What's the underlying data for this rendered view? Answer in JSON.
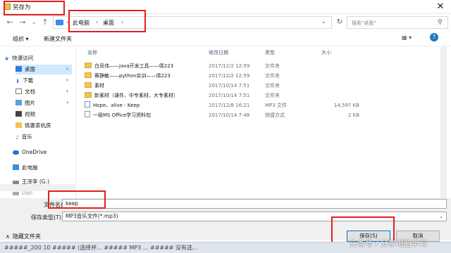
{
  "window": {
    "title": "另存为",
    "close_glyph": "✕"
  },
  "nav": {
    "back": "←",
    "forward": "→",
    "dropdown": "⌄",
    "up": "↑",
    "breadcrumb": [
      "此电脑",
      "桌面"
    ],
    "sep": "›",
    "refresh": "↻",
    "search_placeholder": "搜索\"桌面\""
  },
  "toolbar": {
    "organize": "组织 ▾",
    "new_folder": "新建文件夹",
    "view": "▦ ▾",
    "help": "?"
  },
  "sidebar": [
    {
      "label": "快速访问",
      "icon": "star-icon"
    },
    {
      "label": "桌面",
      "icon": "desktop-icon",
      "pin": "✦"
    },
    {
      "label": "下载",
      "icon": "download-icon",
      "pin": "✦"
    },
    {
      "label": "文档",
      "icon": "document-icon",
      "pin": "✦"
    },
    {
      "label": "图片",
      "icon": "picture-icon",
      "pin": "✦"
    },
    {
      "label": "视频",
      "icon": "video-icon"
    },
    {
      "label": "倩惠茶杭房",
      "icon": "folder-icon"
    },
    {
      "label": "音乐",
      "icon": "music-icon"
    },
    {
      "label": "OneDrive",
      "icon": "cloud-icon"
    },
    {
      "label": "此电脑",
      "icon": "computer-icon"
    },
    {
      "label": "王泽李 (G:)",
      "icon": "drive-icon"
    },
    {
      "label": "Dan",
      "icon": "drive-icon"
    }
  ],
  "columns": {
    "name": "名称",
    "modified": "修改日期",
    "type": "类型",
    "size": "大小"
  },
  "files": [
    {
      "name": "白凤伟——java开发工具——倩223",
      "date": "2017/12/2 12:59",
      "type": "文件夹",
      "size": "",
      "icon": "folder-icon"
    },
    {
      "name": "蔡静敏——python实训——倩223",
      "date": "2017/12/2 12:59",
      "type": "文件夹",
      "size": "",
      "icon": "folder-icon"
    },
    {
      "name": "素材",
      "date": "2017/10/14 7:51",
      "type": "文件夹",
      "size": "",
      "icon": "folder-icon"
    },
    {
      "name": "新素材（课件、中专素材、大专素材）",
      "date": "2017/10/14 7:51",
      "type": "文件夹",
      "size": "",
      "icon": "folder-icon"
    },
    {
      "name": "Hope、alive - Keep",
      "date": "2017/12/8 16:21",
      "type": "MP3 文件",
      "size": "14,597 KB",
      "icon": "mp3-icon"
    },
    {
      "name": "一级MS Office学习资料包",
      "date": "2017/10/14 7:48",
      "type": "快捷方式",
      "size": "2 KB",
      "icon": "shortcut-icon"
    }
  ],
  "form": {
    "filename_label": "文件名(N):",
    "filename_value": "keep",
    "filetype_label": "保存类型(T):",
    "filetype_value": "MP3音乐文件(*.mp3)",
    "hide_folders": "隐藏文件夹",
    "save": "保存(S)",
    "cancel": "取消"
  },
  "status": {
    "text": "#####_200 10 ##### (选择并... ##### MP3 ... ##### 没有选..."
  },
  "watermark": "头条号 / 分享电脑学习",
  "colors": {
    "accent": "#0078d7",
    "highlight": "#e02020",
    "selected": "#cde8ff"
  }
}
